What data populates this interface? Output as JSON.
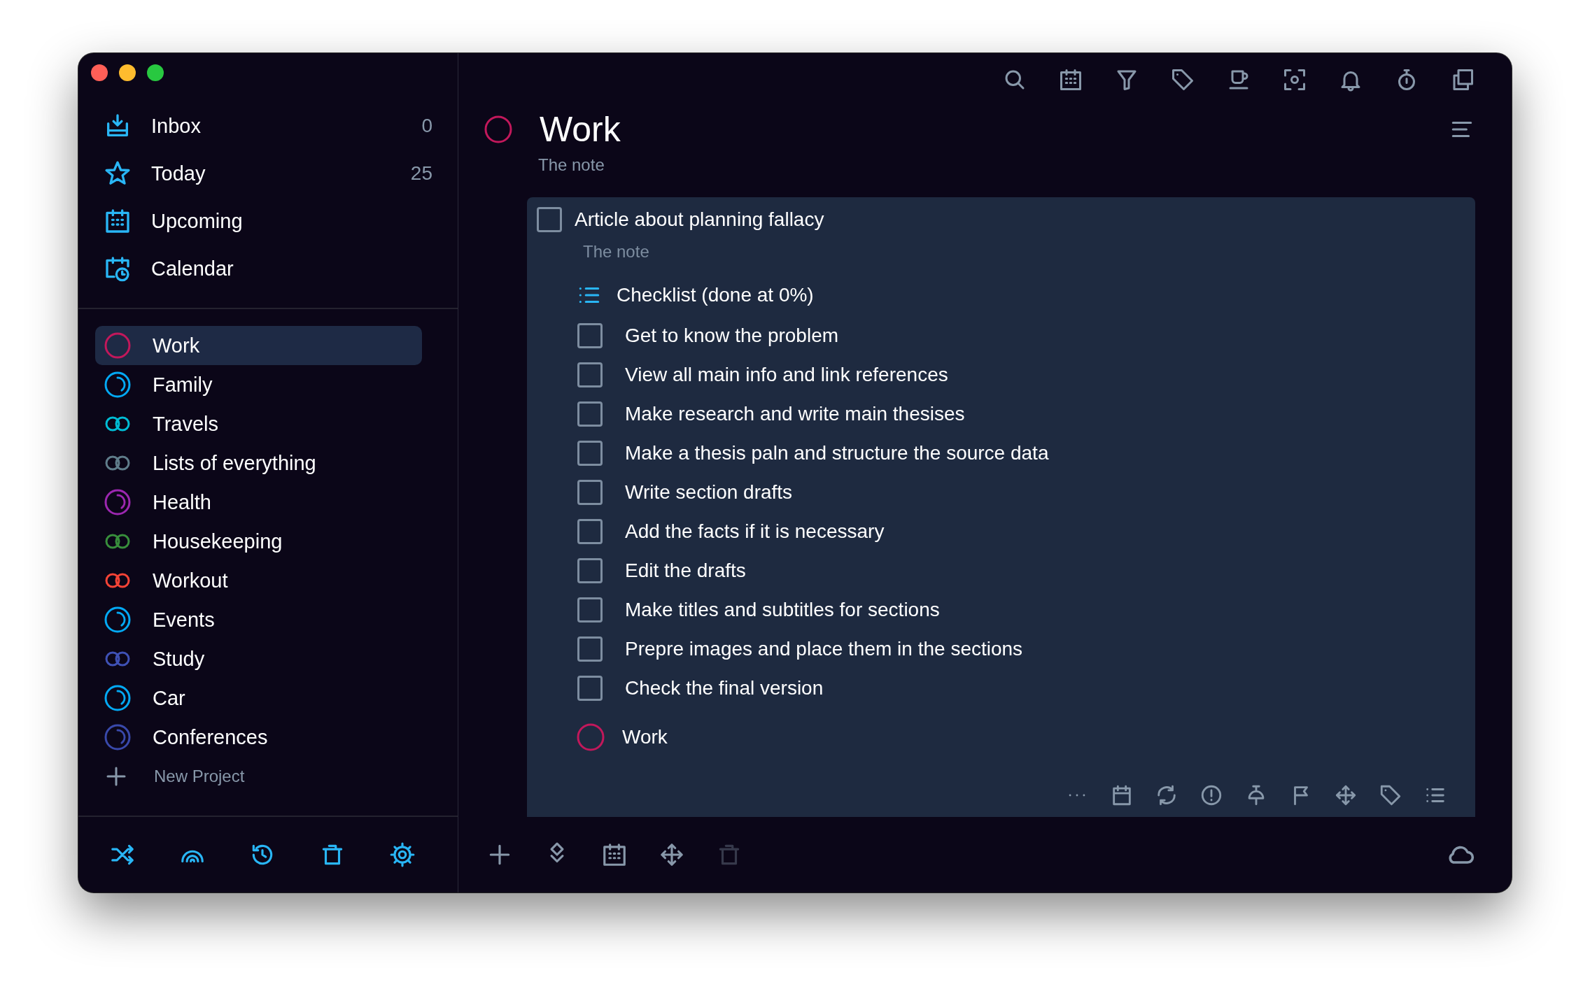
{
  "sidebar": {
    "views": [
      {
        "label": "Inbox",
        "count": "0",
        "selected": false
      },
      {
        "label": "Today",
        "count": "25",
        "selected": false
      },
      {
        "label": "Upcoming",
        "selected": false
      },
      {
        "label": "Calendar",
        "selected": false
      }
    ],
    "projects": [
      {
        "name": "Work",
        "kind": "ring",
        "color": "#c2185b",
        "selected": true
      },
      {
        "name": "Family",
        "kind": "progress",
        "color": "#03a9f4",
        "selected": false
      },
      {
        "name": "Travels",
        "kind": "linked",
        "color": "#00bcd4",
        "selected": false
      },
      {
        "name": "Lists of everything",
        "kind": "linked",
        "color": "#607d8b",
        "selected": false
      },
      {
        "name": "Health",
        "kind": "progress",
        "color": "#9c27b0",
        "selected": false
      },
      {
        "name": "Housekeeping",
        "kind": "linked",
        "color": "#388e3c",
        "selected": false
      },
      {
        "name": "Workout",
        "kind": "linked",
        "color": "#f44336",
        "selected": false
      },
      {
        "name": "Events",
        "kind": "progress",
        "color": "#03a9f4",
        "selected": false
      },
      {
        "name": "Study",
        "kind": "linked",
        "color": "#3f51b5",
        "selected": false
      },
      {
        "name": "Car",
        "kind": "progress",
        "color": "#03a9f4",
        "selected": false
      },
      {
        "name": "Conferences",
        "kind": "progress",
        "color": "#3949ab",
        "selected": false
      }
    ],
    "new_project": "New Project"
  },
  "project": {
    "title": "Work",
    "color": "#c2185b",
    "note": "The note"
  },
  "task": {
    "title": "Article about planning fallacy",
    "checked": false,
    "note": "The note",
    "checklist_title": "Checklist (done at 0%)",
    "checklist": [
      {
        "text": "Get to know the problem",
        "checked": false
      },
      {
        "text": "View all main info and link references",
        "checked": false
      },
      {
        "text": "Make research and write main thesises",
        "checked": false
      },
      {
        "text": "Make a thesis paln and structure the source data",
        "checked": false
      },
      {
        "text": "Write section drafts",
        "checked": false
      },
      {
        "text": "Add the facts if it is necessary",
        "checked": false
      },
      {
        "text": "Edit the drafts",
        "checked": false
      },
      {
        "text": "Make titles and subtitles for sections",
        "checked": false
      },
      {
        "text": "Prepre images and place them in the sections",
        "checked": false
      },
      {
        "text": "Check the final version",
        "checked": false
      }
    ],
    "project": {
      "name": "Work",
      "color": "#c2185b"
    }
  },
  "bottom_toolbar": {
    "delete_disabled": true
  }
}
